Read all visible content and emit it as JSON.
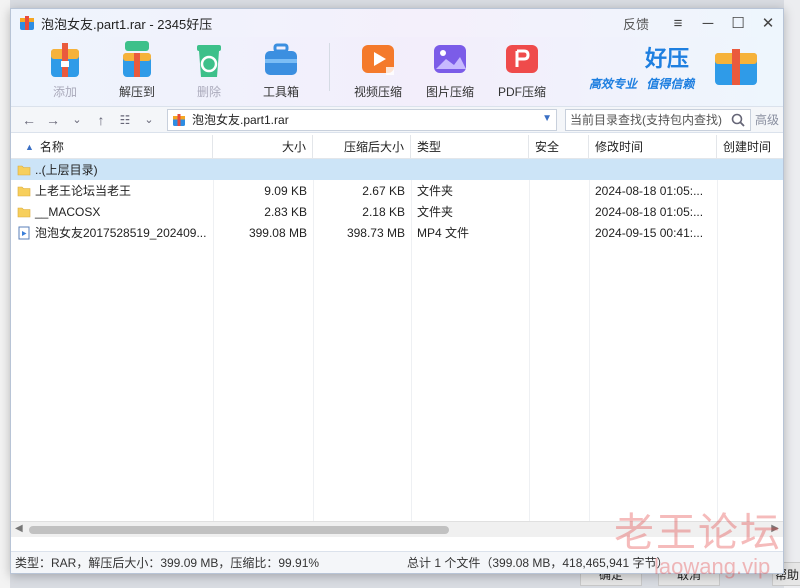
{
  "window": {
    "title": "泡泡女友.part1.rar - 2345好压",
    "feedback_label": "反馈",
    "menu_label": "≡",
    "minimize_label": "─",
    "maximize_label": "☐",
    "close_label": "✕"
  },
  "toolbar": {
    "tools": [
      {
        "label": "添加",
        "icon": "add-archive-icon",
        "enabled": false
      },
      {
        "label": "解压到",
        "icon": "extract-icon",
        "enabled": true
      },
      {
        "label": "删除",
        "icon": "recycle-delete-icon",
        "enabled": false
      },
      {
        "label": "工具箱",
        "icon": "toolbox-icon",
        "enabled": true
      },
      {
        "label": "视频压缩",
        "icon": "video-compress-icon",
        "enabled": true
      },
      {
        "label": "图片压缩",
        "icon": "image-compress-icon",
        "enabled": true
      },
      {
        "label": "PDF压缩",
        "icon": "pdf-compress-icon",
        "enabled": true
      }
    ],
    "brand": {
      "name": "好压",
      "slogan_1": "高效专业",
      "slogan_2": "值得信赖"
    }
  },
  "address": {
    "path": "泡泡女友.part1.rar",
    "search_placeholder": "当前目录查找(支持包内查找)",
    "advanced_label": "高级"
  },
  "table": {
    "columns": [
      "名称",
      "大小",
      "压缩后大小",
      "类型",
      "安全",
      "修改时间",
      "创建时间"
    ],
    "rows": [
      {
        "name": "..(上层目录)",
        "size": "",
        "packed": "",
        "type": "",
        "security": "",
        "modified": "",
        "created": "",
        "icon": "folder-icon",
        "selected": true
      },
      {
        "name": "上老王论坛当老王",
        "size": "9.09 KB",
        "packed": "2.67 KB",
        "type": "文件夹",
        "security": "",
        "modified": "2024-08-18 01:05:...",
        "created": "",
        "icon": "folder-icon",
        "selected": false
      },
      {
        "name": "__MACOSX",
        "size": "2.83 KB",
        "packed": "2.18 KB",
        "type": "文件夹",
        "security": "",
        "modified": "2024-08-18 01:05:...",
        "created": "",
        "icon": "folder-icon",
        "selected": false
      },
      {
        "name": "泡泡女友2017528519_202409...",
        "size": "399.08 MB",
        "packed": "398.73 MB",
        "type": "MP4 文件",
        "security": "",
        "modified": "2024-09-15 00:41:...",
        "created": "",
        "icon": "video-file-icon",
        "selected": false
      }
    ]
  },
  "status": {
    "left": "类型：RAR，解压后大小：399.09 MB，压缩比：99.91%",
    "right": "总计 1 个文件（399.08 MB，418,465,941 字节）"
  },
  "watermark": {
    "line1": "老王论坛",
    "line2": "laowang.vip"
  },
  "background_buttons": {
    "ok": "确定",
    "cancel": "取消",
    "help": "帮助"
  }
}
